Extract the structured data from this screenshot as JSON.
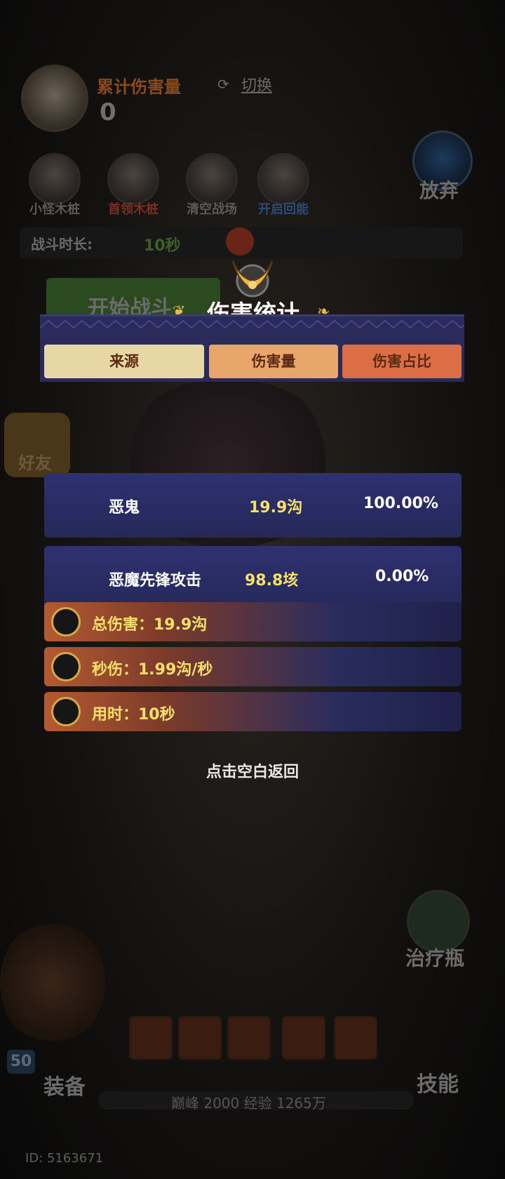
{
  "hud": {
    "cumulative_damage_label": "累计伤害量",
    "cumulative_damage_value": "0",
    "switch_label": "切换"
  },
  "tools": [
    {
      "label": "小怪木桩"
    },
    {
      "label": "首领木桩"
    },
    {
      "label": "清空战场"
    },
    {
      "label": "开启回能"
    }
  ],
  "give_up_label": "放弃",
  "battle": {
    "duration_label": "战斗时长:",
    "duration_value": "10秒",
    "start_label": "开始战斗"
  },
  "friend_label": "好友",
  "potion_label": "治疗瓶",
  "equip_label": "装备",
  "skill_label": "技能",
  "level_badge": "50",
  "xp_text": "巅峰 2000   经验 1265万",
  "id_text": "ID: 5163671",
  "modal": {
    "title": "伤害统计",
    "headers": {
      "source": "来源",
      "damage": "伤害量",
      "percent": "伤害占比"
    },
    "rows": [
      {
        "source": "恶鬼",
        "damage": "19.9沟",
        "percent": "100.00%"
      },
      {
        "source": "恶魔先锋攻击",
        "damage": "98.8垓",
        "percent": "0.00%"
      }
    ],
    "stats": {
      "total": "总伤害：19.9沟",
      "dps": "秒伤：1.99沟/秒",
      "time": "用时：10秒"
    },
    "close_hint": "点击空白返回"
  },
  "colors": {
    "header_source": "#e7d7a4",
    "header_damage": "#e8a66a",
    "header_percent": "#dc6e46",
    "row_bg": "#2e3170",
    "damage_text": "#f5e06c"
  },
  "icons": {
    "emblem": "winged-helmet-emblem-icon",
    "stat_total": "demon-mask-icon",
    "stat_dps": "demon-mask-icon",
    "stat_time": "hourglass-icon"
  }
}
